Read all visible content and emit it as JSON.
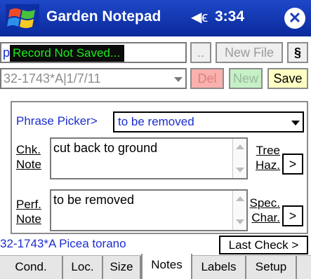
{
  "titlebar": {
    "app_title": "Garden Notepad",
    "time": "3:34",
    "speaker_glyph": "◀ϵ",
    "close_glyph": "✕",
    "colors": {
      "background": "#1a3fb8",
      "text": "#ffffff"
    }
  },
  "file_row": {
    "file_path": "p\\G",
    "status_badge": "Record Not Saved...",
    "browse_label": "..",
    "new_file_label": "New File",
    "section_label": "§"
  },
  "record_row": {
    "record_value": "32-1743*A|1/7/11",
    "del_label": "Del",
    "new_label": "New",
    "save_label": "Save",
    "colors": {
      "del": "#f9b1ad",
      "new": "#c6f0c6",
      "save": "#ffffc4"
    }
  },
  "panel": {
    "phrase_picker_label": "Phrase Picker>",
    "phrase_value": "to be removed",
    "chk_note": {
      "label_line1": "Chk.",
      "label_line2": "Note",
      "value": "cut back to ground"
    },
    "perf_note": {
      "label_line1": "Perf.",
      "label_line2": "Note",
      "value": "to be removed"
    },
    "tree_haz": {
      "label_line1": "Tree",
      "label_line2": "Haz.",
      "button": ">"
    },
    "spec_char": {
      "label_line1": "Spec.",
      "label_line2": "Char.",
      "button": ">"
    }
  },
  "status": {
    "plant_text": "32-1743*A Picea torano",
    "last_check_label": "Last Check >"
  },
  "tabs": [
    {
      "label": "Cond.",
      "active": false
    },
    {
      "label": "Loc.",
      "active": false
    },
    {
      "label": "Size",
      "active": false
    },
    {
      "label": "Notes",
      "active": true
    },
    {
      "label": "Labels",
      "active": false
    },
    {
      "label": "Setup",
      "active": false
    }
  ],
  "icons": {
    "start": "windows-flag-icon",
    "volume": "speaker-icon",
    "close": "close-icon"
  }
}
